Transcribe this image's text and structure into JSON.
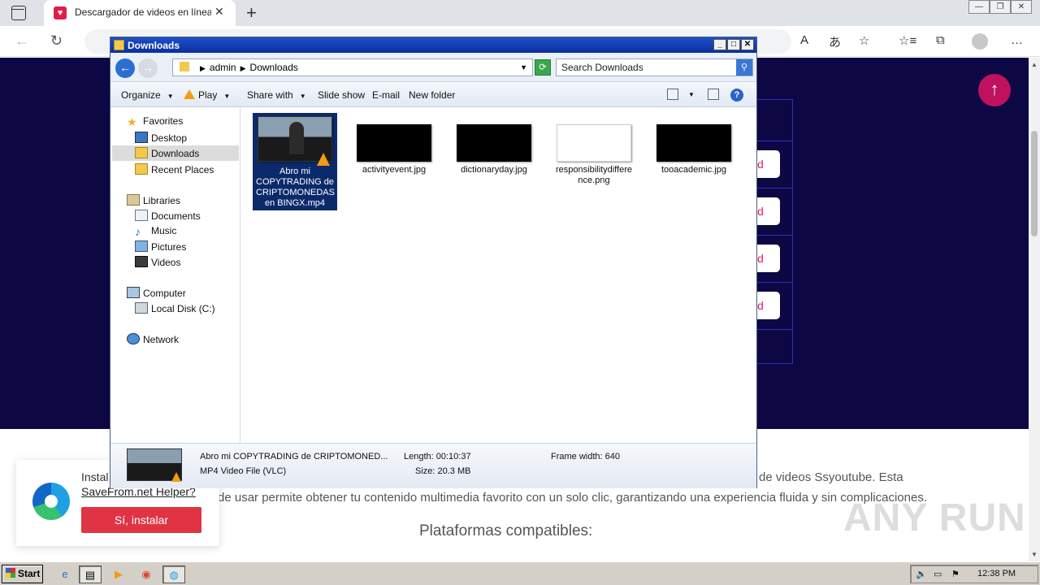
{
  "browser": {
    "tab_title": "Descargador de videos en línea",
    "tab_close": "✕",
    "new_tab": "+",
    "window_controls": [
      "—",
      "❐",
      "✕"
    ],
    "right_icons": [
      "A",
      "あ",
      "☆",
      "☆≡",
      "⧉",
      "…"
    ]
  },
  "page": {
    "download_btn_label": "d",
    "up_arrow": "↑",
    "paragraph_line1": "de videos Ssyoutube. Esta",
    "paragraph_line2": "de usar permite obtener tu contenido multimedia favorito con un solo clic, garantizando una experiencia fluida y sin complicaciones.",
    "platforms_heading": "Plataformas compatibles:",
    "install_title": "Instal",
    "install_link": "SaveFrom.net Helper?",
    "install_button": "Sí, instalar",
    "watermark": "ANY RUN"
  },
  "explorer": {
    "title": "Downloads",
    "controls": [
      "_",
      "□",
      "✕"
    ],
    "breadcrumb": [
      "admin",
      "Downloads"
    ],
    "search_placeholder": "Search Downloads",
    "toolbar": {
      "organize": "Organize",
      "play": "Play",
      "share_with": "Share with",
      "slide_show": "Slide show",
      "email": "E-mail",
      "new_folder": "New folder",
      "help": "?"
    },
    "nav": {
      "favorites": "Favorites",
      "desktop": "Desktop",
      "downloads": "Downloads",
      "recent_places": "Recent Places",
      "libraries": "Libraries",
      "documents": "Documents",
      "music": "Music",
      "pictures": "Pictures",
      "videos": "Videos",
      "computer": "Computer",
      "local_disk": "Local Disk (C:)",
      "network": "Network"
    },
    "files": [
      {
        "name": "Abro mi COPYTRADING de CRIPTOMONEDAS en BINGX.mp4",
        "selected": true
      },
      {
        "name": "activityevent.jpg",
        "selected": false
      },
      {
        "name": "dictionaryday.jpg",
        "selected": false
      },
      {
        "name": "responsibilitydifference.png",
        "selected": false
      },
      {
        "name": "tooacademic.jpg",
        "selected": false
      }
    ],
    "details": {
      "name": "Abro mi COPYTRADING de CRIPTOMONED...",
      "type": "MP4 Video File (VLC)",
      "length": "Length: 00:10:37",
      "size": "Size: 20.3 MB",
      "frame_width": "Frame width: 640"
    }
  },
  "taskbar": {
    "start": "Start",
    "clock": "12:38 PM"
  }
}
